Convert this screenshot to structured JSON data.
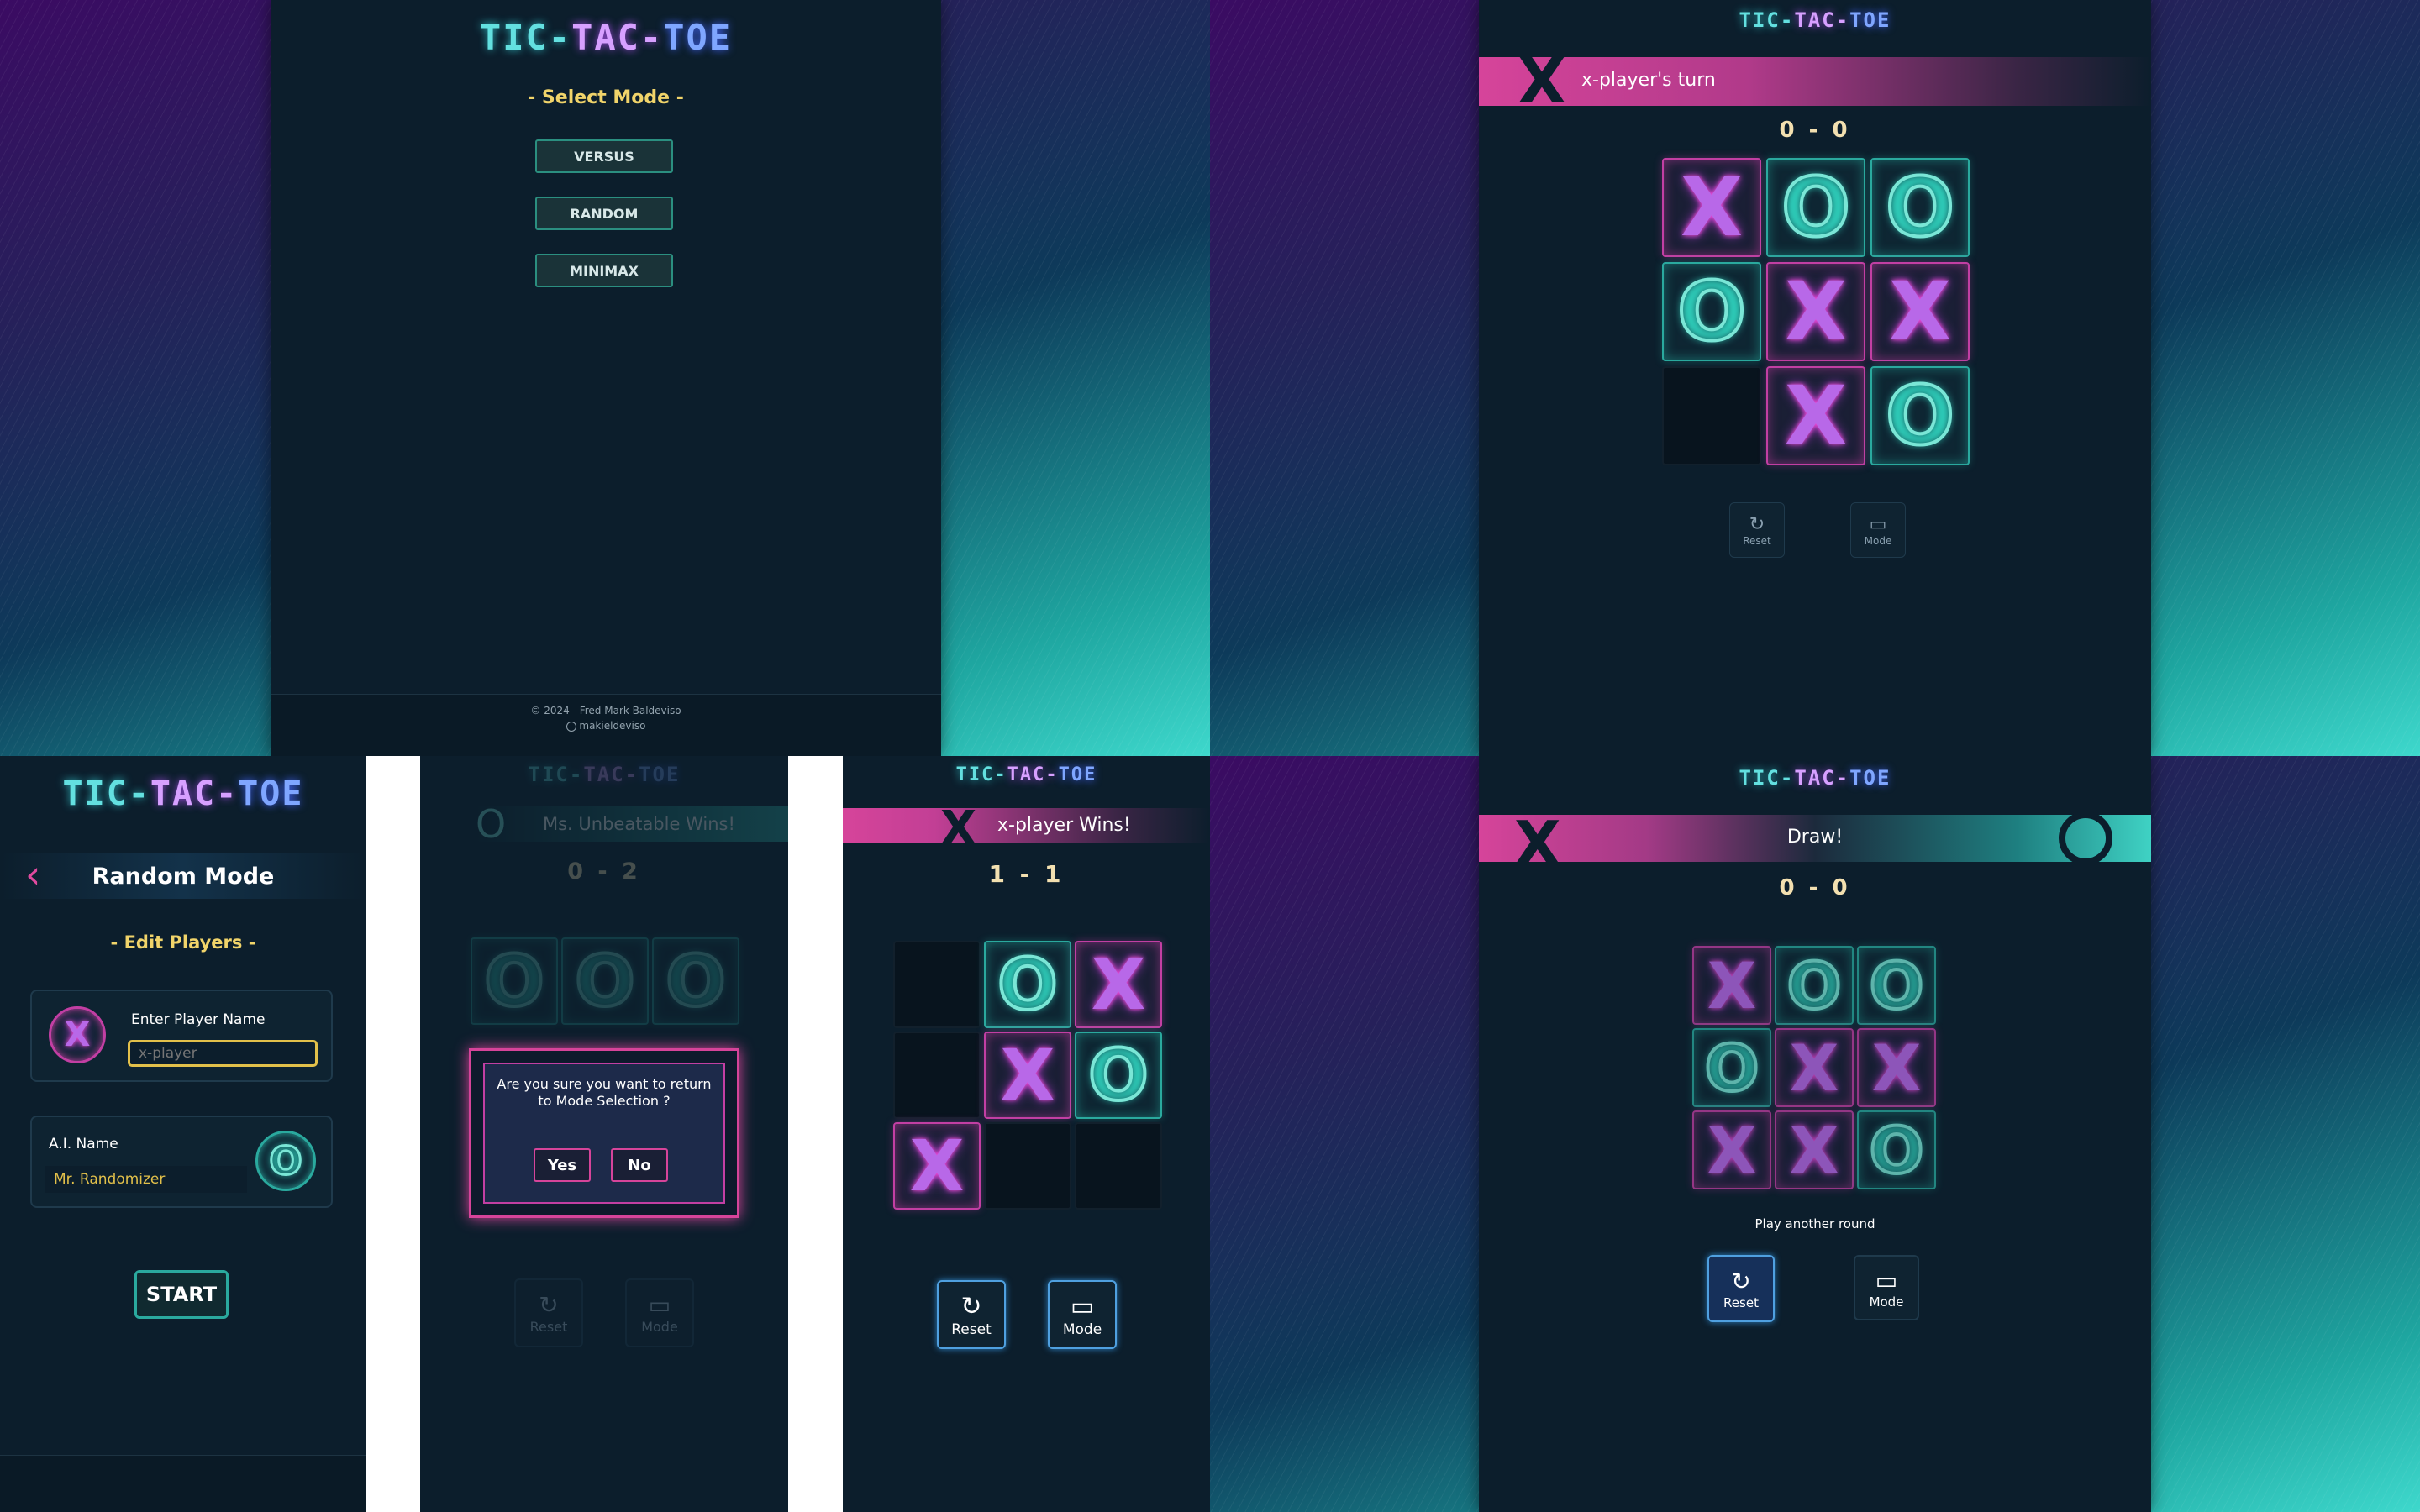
{
  "logo": {
    "p1": "TIC-",
    "p2": "TAC-",
    "p3": "TOE"
  },
  "select_mode": {
    "heading": "- Select Mode -",
    "buttons": [
      "VERSUS",
      "RANDOM",
      "MINIMAX"
    ],
    "footer_line1": "© 2024 - Fred Mark Baldeviso",
    "footer_line2": "makieldeviso"
  },
  "turn_screen": {
    "banner": "x-player's turn",
    "score": "0 - 0",
    "board": [
      "X",
      "O",
      "O",
      "O",
      "X",
      "X",
      "",
      "X",
      "O"
    ],
    "reset_label": "Reset",
    "mode_label": "Mode"
  },
  "edit_players": {
    "title": "Random Mode",
    "heading": "- Edit Players -",
    "player_label": "Enter Player Name",
    "player_placeholder": "x-player",
    "ai_label": "A.I. Name",
    "ai_name": "Mr. Randomizer",
    "start_label": "START"
  },
  "confirm_screen": {
    "banner": "Ms. Unbeatable Wins!",
    "score": "0 - 2",
    "board_row": [
      "O",
      "O",
      "O"
    ],
    "question": "Are you sure you want to return to Mode Selection ?",
    "yes_label": "Yes",
    "no_label": "No",
    "reset_label": "Reset",
    "mode_label": "Mode"
  },
  "win_screen": {
    "banner": "x-player Wins!",
    "score": "1 - 1",
    "board": [
      "",
      "O",
      "X",
      "",
      "X",
      "O",
      "X",
      "",
      ""
    ],
    "reset_label": "Reset",
    "mode_label": "Mode"
  },
  "draw_screen": {
    "banner": "Draw!",
    "score": "0 - 0",
    "board": [
      "X",
      "O",
      "O",
      "O",
      "X",
      "X",
      "X",
      "X",
      "O"
    ],
    "play_again": "Play another round",
    "reset_label": "Reset",
    "mode_label": "Mode"
  },
  "icons": {
    "x_mark": "X",
    "o_mark": "O",
    "back": "‹",
    "reset_icon": "↻",
    "mode_icon": "▭"
  }
}
